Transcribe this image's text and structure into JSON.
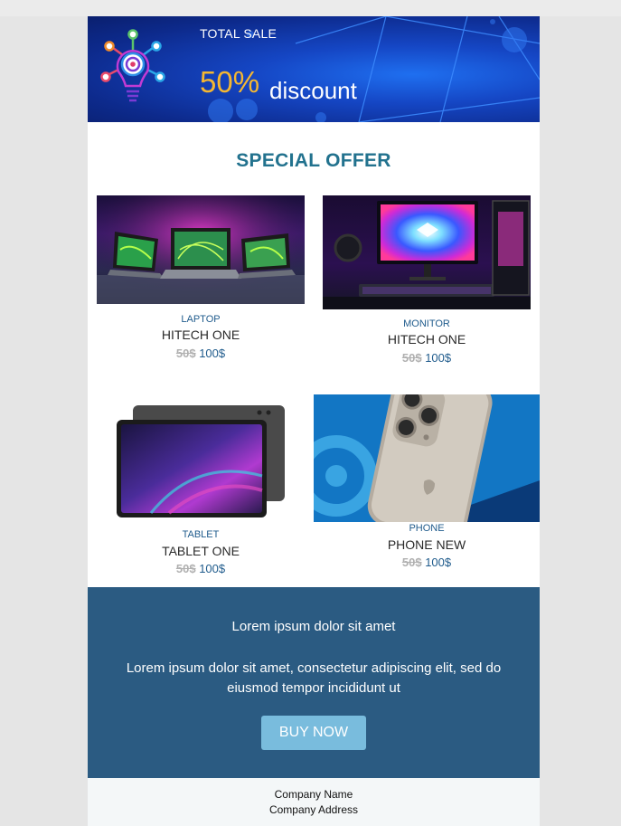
{
  "banner": {
    "headline": "TOTAL SALE",
    "percent": "50%",
    "discount_word": "discount"
  },
  "offer": {
    "title": "SPECIAL OFFER"
  },
  "products": [
    {
      "category": "LAPTOP",
      "name": "HITECH ONE",
      "old_price": "50$",
      "new_price": "100$",
      "image": "laptops-image"
    },
    {
      "category": "MONITOR",
      "name": "HITECH ONE",
      "old_price": "50$",
      "new_price": "100$",
      "image": "monitor-setup-image"
    },
    {
      "category": "TABLET",
      "name": "TABLET ONE",
      "old_price": "50$",
      "new_price": "100$",
      "image": "tablet-image"
    },
    {
      "category": "PHONE",
      "name": "PHONE NEW",
      "old_price": "50$",
      "new_price": "100$",
      "image": "phone-image"
    }
  ],
  "cta": {
    "heading": "Lorem ipsum dolor sit amet",
    "body": "Lorem ipsum dolor sit amet, consectetur adipiscing elit, sed do eiusmod tempor incididunt ut",
    "button_label": "BUY NOW"
  },
  "footer": {
    "company_name": "Company Name",
    "company_address": "Company Address"
  },
  "colors": {
    "accent_title": "#22728e",
    "cta_background": "#2b5b82",
    "button": "#79bcdd",
    "discount_percent": "#f5b731",
    "price_new": "#1f5b8c"
  }
}
